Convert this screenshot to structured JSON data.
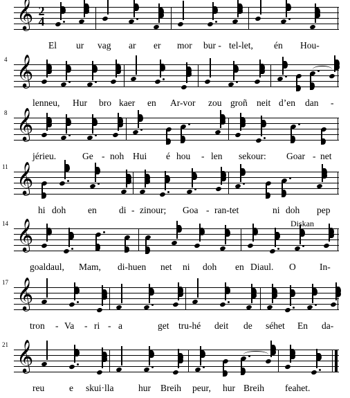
{
  "score": {
    "clef": "treble-clef",
    "clef_glyph": "𝄞",
    "time_signature": {
      "numerator": "2",
      "denominator": "4"
    },
    "markings": [
      {
        "text": "Diskan",
        "system": 5
      }
    ],
    "systems": [
      {
        "index": 1,
        "measure_number": "",
        "lyrics": [
          "El",
          "ur",
          "vag",
          "ar",
          "er",
          "mor",
          "bur -",
          "tel-let,",
          "én",
          "Hou-"
        ]
      },
      {
        "index": 2,
        "measure_number": "4",
        "lyrics": [
          "lenneu,",
          "Hur",
          "bro",
          "kaer",
          "en",
          "Ar-vor",
          "zou",
          "groñ",
          "neit",
          "d’en",
          "dan",
          "-"
        ]
      },
      {
        "index": 3,
        "measure_number": "8",
        "lyrics": [
          "jérieu.",
          "Ge",
          "-",
          "noh",
          "Hui",
          "é",
          "hou",
          "-",
          "len",
          "sekour:",
          "Goar",
          "-",
          "net"
        ]
      },
      {
        "index": 4,
        "measure_number": "11",
        "lyrics": [
          "hi",
          "doh",
          "en",
          "di",
          "-",
          "zinour;",
          "Goa",
          "-",
          "ran-tet",
          "ni",
          "doh",
          "pep"
        ]
      },
      {
        "index": 5,
        "measure_number": "14",
        "lyrics": [
          "goaldaul,",
          "Mam,",
          "di-huen",
          "net",
          "ni",
          "doh",
          "en",
          "Diaul.",
          "O",
          "In-"
        ]
      },
      {
        "index": 6,
        "measure_number": "17",
        "lyrics": [
          "tron",
          "-",
          "Va",
          "-",
          "ri",
          "-",
          "a",
          "get",
          "tru-hé",
          "deit",
          "de",
          "séhet",
          "En",
          "da-"
        ]
      },
      {
        "index": 7,
        "measure_number": "21",
        "lyrics": [
          "reu",
          "e",
          "skui·lla",
          "hur",
          "Breih",
          "peur,",
          "hur",
          "Breih",
          "feahet."
        ]
      }
    ]
  },
  "lyrics_flat": {
    "s1": [
      "El",
      "ur",
      "vag",
      "ar",
      "er",
      "mor",
      "bur -",
      "tel-let,",
      "én",
      "Hou-"
    ],
    "s2": [
      "lenneu,",
      "Hur",
      "bro",
      "kaer",
      "en",
      "Ar-vor",
      "zou",
      "groñ",
      "neit",
      "d’en",
      "dan",
      "-"
    ],
    "s3": [
      "jérieu.",
      "Ge",
      "-",
      "noh",
      "Hui",
      "é",
      "hou",
      "-",
      "len",
      "sekour:",
      "Goar",
      "-",
      "net"
    ],
    "s4": [
      "hi",
      "doh",
      "en",
      "di",
      "-",
      "zinour;",
      "Goa",
      "-",
      "ran-tet",
      "ni",
      "doh",
      "pep"
    ],
    "s5": [
      "goaldaul,",
      "Mam,",
      "di-huen",
      "net",
      "ni",
      "doh",
      "en",
      "Diaul.",
      "O",
      "In-"
    ],
    "s6": [
      "tron",
      "-",
      "Va",
      "-",
      "ri",
      "-",
      "a",
      "get",
      "tru-hé",
      "deit",
      "de",
      "séhet",
      "En",
      "da-"
    ],
    "s7": [
      "reu",
      "e",
      "skui·lla",
      "hur",
      "Breih",
      "peur,",
      "hur",
      "Breih",
      "feahet."
    ]
  },
  "measure_numbers": {
    "m1": "",
    "m4": "4",
    "m8": "8",
    "m11": "11",
    "m14": "14",
    "m17": "17",
    "m21": "21"
  },
  "colors": {
    "ink": "#000000",
    "paper": "#ffffff"
  }
}
